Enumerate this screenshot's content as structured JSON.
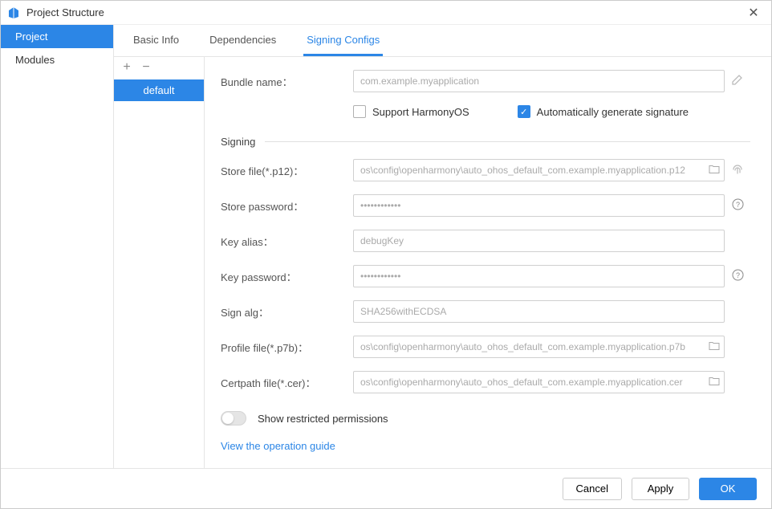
{
  "window": {
    "title": "Project Structure"
  },
  "sidebar": {
    "items": [
      {
        "label": "Project",
        "active": true
      },
      {
        "label": "Modules",
        "active": false
      }
    ]
  },
  "tabs": [
    {
      "label": "Basic Info",
      "active": false
    },
    {
      "label": "Dependencies",
      "active": false
    },
    {
      "label": "Signing Configs",
      "active": true
    }
  ],
  "configs": {
    "items": [
      {
        "label": "default",
        "active": true
      }
    ]
  },
  "form": {
    "bundle_name_label": "Bundle name：",
    "bundle_name_value": "com.example.myapplication",
    "support_harmony_label": "Support HarmonyOS",
    "support_harmony_checked": false,
    "auto_sig_label": "Automatically generate signature",
    "auto_sig_checked": true,
    "signing_header": "Signing",
    "store_file_label": "Store file(*.p12)：",
    "store_file_value": "os\\config\\openharmony\\auto_ohos_default_com.example.myapplication.p12",
    "store_password_label": "Store password：",
    "store_password_value": "••••••••••••",
    "key_alias_label": "Key alias：",
    "key_alias_value": "debugKey",
    "key_password_label": "Key password：",
    "key_password_value": "••••••••••••",
    "sign_alg_label": "Sign alg：",
    "sign_alg_value": "SHA256withECDSA",
    "profile_file_label": "Profile file(*.p7b)：",
    "profile_file_value": "os\\config\\openharmony\\auto_ohos_default_com.example.myapplication.p7b",
    "certpath_file_label": "Certpath file(*.cer)：",
    "certpath_file_value": "os\\config\\openharmony\\auto_ohos_default_com.example.myapplication.cer",
    "show_restricted_label": "Show restricted permissions",
    "show_restricted_on": false,
    "guide_link": "View the operation guide"
  },
  "footer": {
    "cancel": "Cancel",
    "apply": "Apply",
    "ok": "OK"
  }
}
